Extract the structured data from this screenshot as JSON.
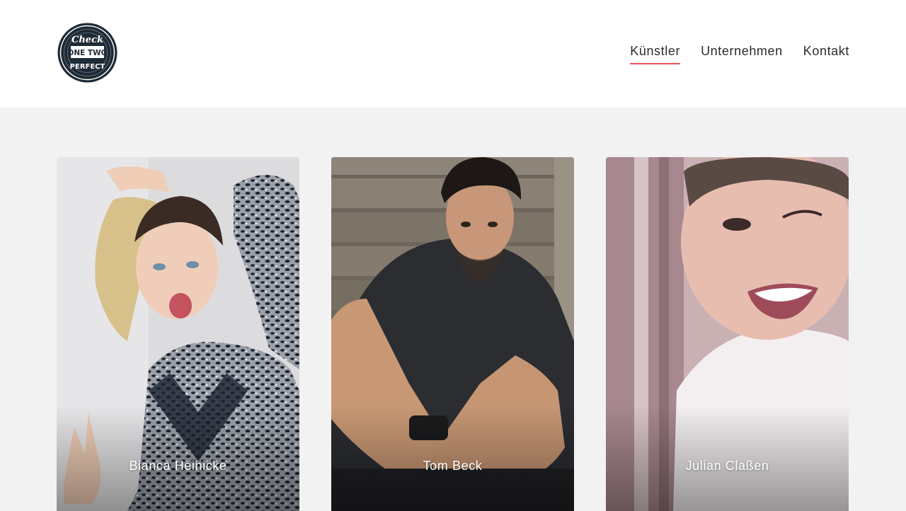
{
  "logo": {
    "line1": "Check",
    "line2": "ONE TWO",
    "line3": "PERFECT"
  },
  "nav": {
    "items": [
      {
        "label": "Künstler",
        "active": true
      },
      {
        "label": "Unternehmen",
        "active": false
      },
      {
        "label": "Kontakt",
        "active": false
      }
    ]
  },
  "artists": [
    {
      "name": "Bianca Heinicke"
    },
    {
      "name": "Tom Beck"
    },
    {
      "name": "Julian Claßen"
    }
  ],
  "colors": {
    "accent": "#e8505b",
    "header_bg": "#ffffff",
    "page_bg": "#f2f2f2",
    "text": "#2a2a2a"
  }
}
